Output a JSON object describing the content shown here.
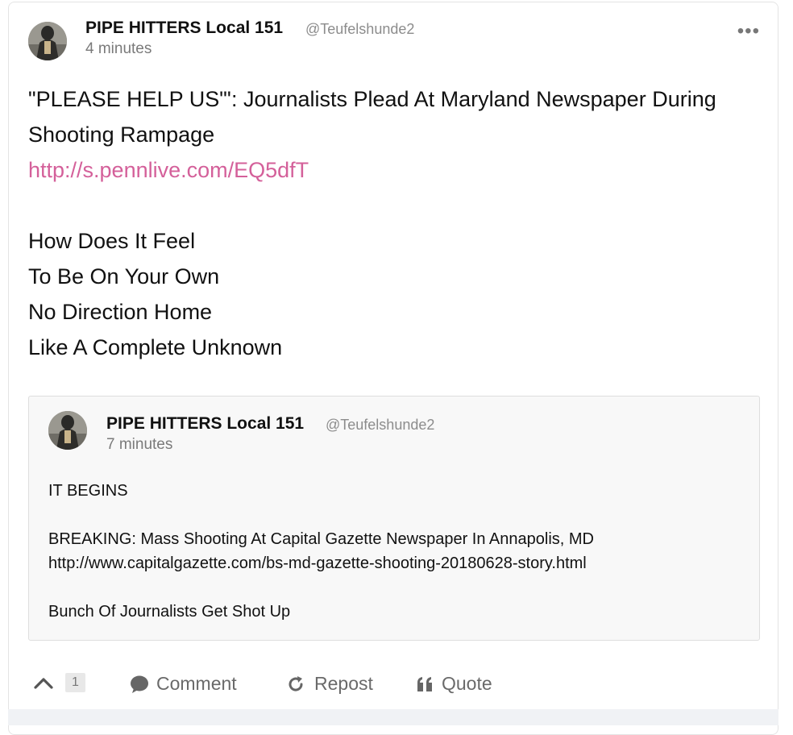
{
  "post": {
    "author": {
      "name": "PIPE HITTERS Local 151",
      "handle": "@Teufelshunde2"
    },
    "time": "4 minutes",
    "more_label": "•••",
    "lines": [
      "\"PLEASE HELP US\"': Journalists Plead At Maryland Newspaper During",
      "Shooting Rampage"
    ],
    "link": "http://s.pennlive.com/EQ5dfT",
    "lyrics": [
      "How Does It Feel",
      "To Be On Your Own",
      "No Direction Home",
      "Like A Complete Unknown"
    ]
  },
  "quoted_post": {
    "author": {
      "name": "PIPE HITTERS Local 151",
      "handle": "@Teufelshunde2"
    },
    "time": "7 minutes",
    "lines": [
      "IT BEGINS",
      "",
      "BREAKING: Mass Shooting At Capital Gazette Newspaper In Annapolis, MD",
      "http://www.capitalgazette.com/bs-md-gazette-shooting-20180628-story.html",
      "",
      "Bunch Of Journalists Get Shot Up"
    ]
  },
  "actions": {
    "upvote_count": "1",
    "comment_label": "Comment",
    "repost_label": "Repost",
    "quote_label": "Quote"
  },
  "icons": {
    "upvote": "chevron-up-icon",
    "comment": "speech-bubble-icon",
    "repost": "refresh-icon",
    "quote": "quote-marks-icon",
    "more": "ellipsis-icon"
  },
  "colors": {
    "link": "#d4609a",
    "muted": "#8c8c8c",
    "quote_bg": "#f8f8f8"
  }
}
